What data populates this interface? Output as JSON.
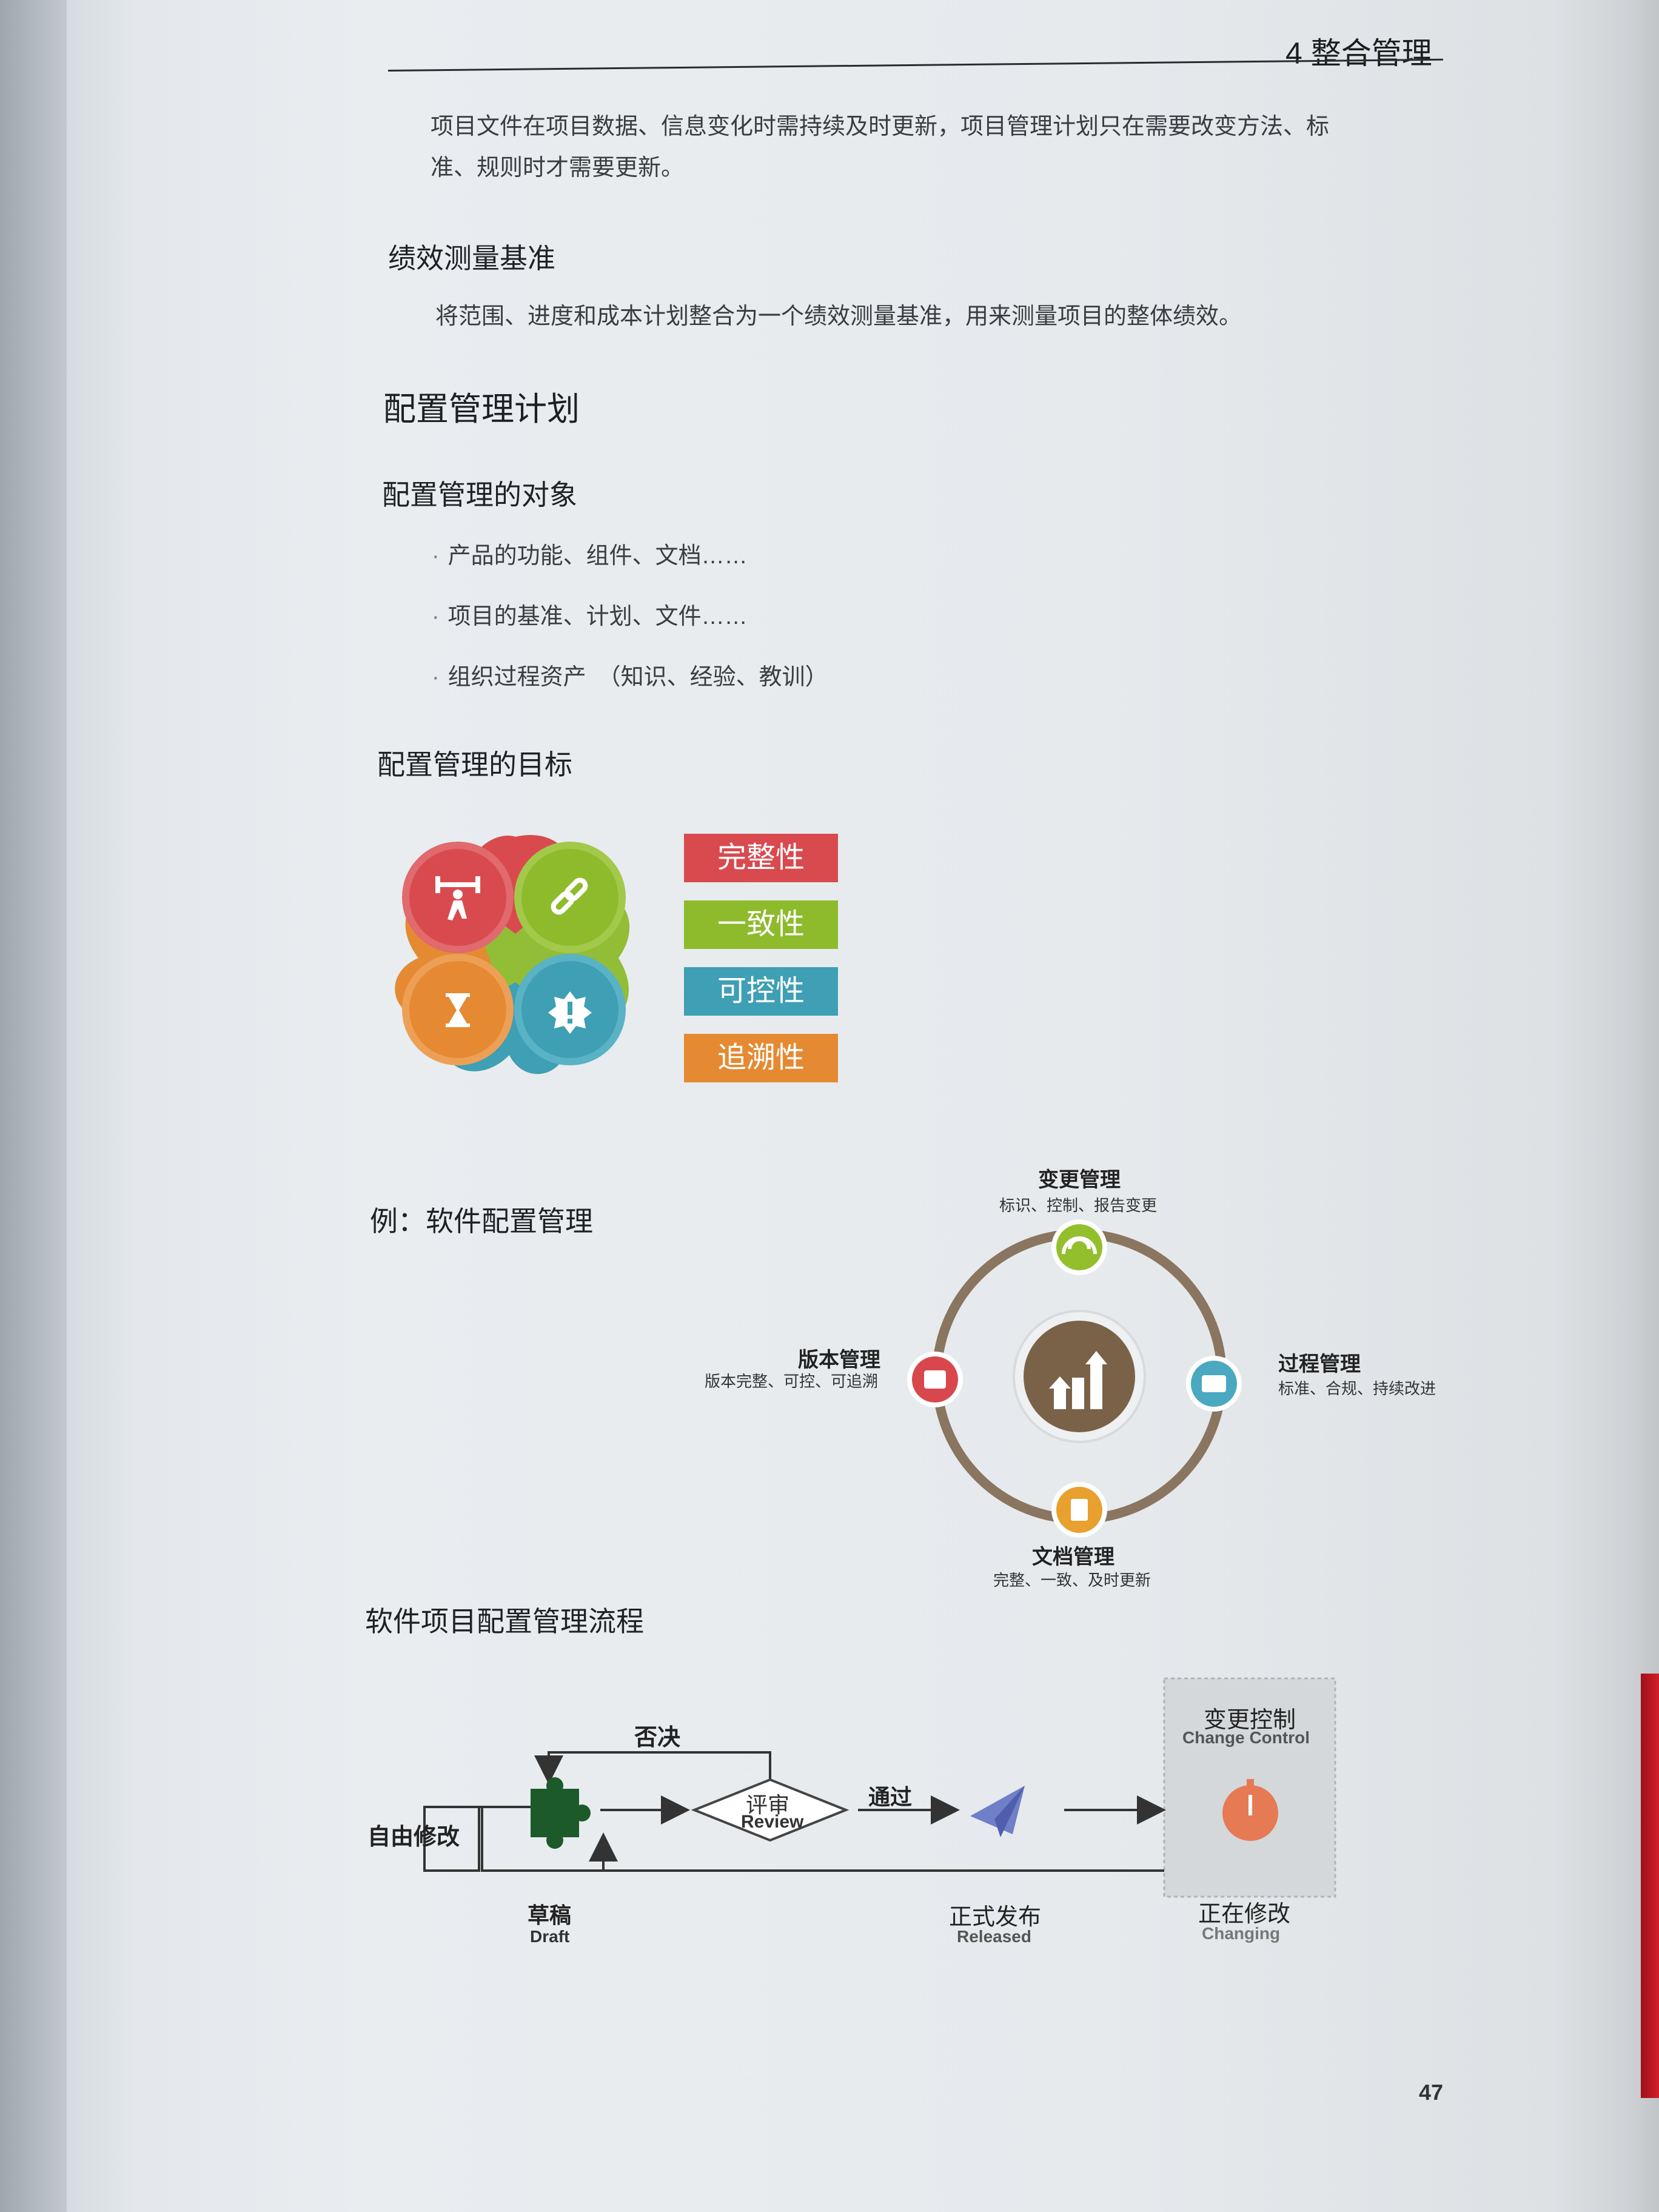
{
  "header": {
    "chapter": "4 整合管理"
  },
  "intro": {
    "line1": "项目文件在项目数据、信息变化时需持续及时更新，项目管理计划只在需要改变方法、标",
    "line2": "准、规则时才需要更新。"
  },
  "perf": {
    "heading": "绩效测量基准",
    "text": "将范围、进度和成本计划整合为一个绩效测量基准，用来测量项目的整体绩效。"
  },
  "config_plan": {
    "title": "配置管理计划",
    "objects_heading": "配置管理的对象",
    "objects": [
      "产品的功能、组件、文档……",
      "项目的基准、计划、文件……",
      "组织过程资产　（知识、经验、教训）"
    ],
    "goals_heading": "配置管理的目标",
    "goals": [
      {
        "label": "完整性",
        "color": "#d94a4f"
      },
      {
        "label": "一致性",
        "color": "#8dbb2c"
      },
      {
        "label": "可控性",
        "color": "#3f9fb4"
      },
      {
        "label": "追溯性",
        "color": "#e58a32"
      }
    ],
    "flower_icons": [
      "weightlifter-icon",
      "chain-link-icon",
      "hourglass-icon",
      "alert-badge-icon"
    ]
  },
  "example": {
    "heading": "例：软件配置管理",
    "nodes": {
      "top": {
        "title": "变更管理",
        "sub": "标识、控制、报告变更",
        "color": "#93bf2c"
      },
      "right": {
        "title": "过程管理",
        "sub": "标准、合规、持续改进",
        "color": "#4aa8c0"
      },
      "bottom": {
        "title": "文档管理",
        "sub": "完整、一致、及时更新",
        "color": "#e8a02e"
      },
      "left": {
        "title": "版本管理",
        "sub": "版本完整、可控、可追溯",
        "color": "#d8474c"
      }
    },
    "center_icon": "growth-chart-icon"
  },
  "process": {
    "heading": "软件项目配置管理流程",
    "free_edit": "自由修改",
    "reject": "否决",
    "review_cn": "评审",
    "review_en": "Review",
    "pass": "通过",
    "draft_cn": "草稿",
    "draft_en": "Draft",
    "released_cn": "正式发布",
    "released_en": "Released",
    "change_control_cn": "变更控制",
    "change_control_en": "Change Control",
    "changing_cn": "正在修改",
    "changing_en": "Changing"
  },
  "page_number": "47"
}
